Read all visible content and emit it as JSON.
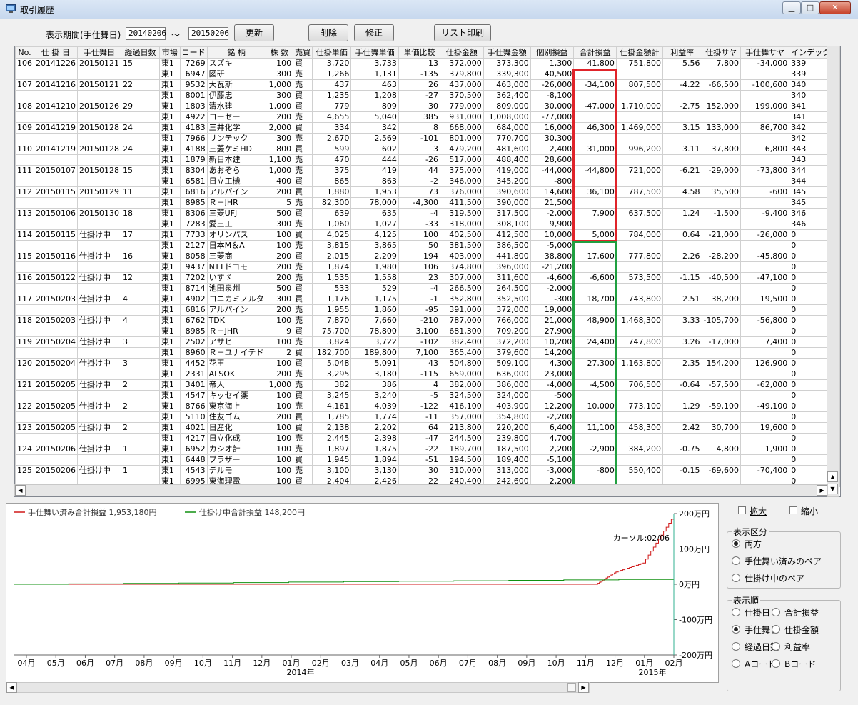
{
  "window": {
    "title": "取引履歴",
    "min": "▁",
    "max": "□",
    "close": "✕"
  },
  "toolbar": {
    "period_label": "表示期間(手仕舞日)",
    "from": "20140206",
    "tilde": "～",
    "to": "20150206",
    "refresh": "更新",
    "delete": "削除",
    "edit": "修正",
    "print": "リスト印刷"
  },
  "columns": [
    "No.",
    "仕 掛 日",
    "手仕舞日",
    "経過日数",
    "市場",
    "コード",
    "銘 柄",
    "株 数",
    "売買",
    "仕掛単価",
    "手仕舞単価",
    "単価比較",
    "仕掛金額",
    "手仕舞金額",
    "個別損益",
    "合計損益",
    "仕掛金額計",
    "利益率",
    "仕掛サヤ",
    "手仕舞サヤ",
    "インデックス"
  ],
  "rows": [
    [
      "106",
      "20141226",
      "20150121",
      "15",
      "東1",
      "7269",
      "スズキ",
      "100",
      "買",
      "3,720",
      "3,733",
      "13",
      "372,000",
      "373,300",
      "1,300",
      "41,800",
      "751,800",
      "5.56",
      "7,800",
      "-34,000",
      "339"
    ],
    [
      "",
      "",
      "",
      "",
      "東1",
      "6947",
      "図研",
      "300",
      "売",
      "1,266",
      "1,131",
      "-135",
      "379,800",
      "339,300",
      "40,500",
      "",
      "",
      "",
      "",
      "",
      "339"
    ],
    [
      "107",
      "20141216",
      "20150121",
      "22",
      "東1",
      "9532",
      "大瓦斯",
      "1,000",
      "売",
      "437",
      "463",
      "26",
      "437,000",
      "463,000",
      "-26,000",
      "-34,100",
      "807,500",
      "-4.22",
      "-66,500",
      "-100,600",
      "340"
    ],
    [
      "",
      "",
      "",
      "",
      "東1",
      "8001",
      "伊藤忠",
      "300",
      "買",
      "1,235",
      "1,208",
      "-27",
      "370,500",
      "362,400",
      "-8,100",
      "",
      "",
      "",
      "",
      "",
      "340"
    ],
    [
      "108",
      "20141210",
      "20150126",
      "29",
      "東1",
      "1803",
      "清水建",
      "1,000",
      "買",
      "779",
      "809",
      "30",
      "779,000",
      "809,000",
      "30,000",
      "-47,000",
      "1,710,000",
      "-2.75",
      "152,000",
      "199,000",
      "341"
    ],
    [
      "",
      "",
      "",
      "",
      "東1",
      "4922",
      "コーセー",
      "200",
      "売",
      "4,655",
      "5,040",
      "385",
      "931,000",
      "1,008,000",
      "-77,000",
      "",
      "",
      "",
      "",
      "",
      "341"
    ],
    [
      "109",
      "20141219",
      "20150128",
      "24",
      "東1",
      "4183",
      "三井化学",
      "2,000",
      "買",
      "334",
      "342",
      "8",
      "668,000",
      "684,000",
      "16,000",
      "46,300",
      "1,469,000",
      "3.15",
      "133,000",
      "86,700",
      "342"
    ],
    [
      "",
      "",
      "",
      "",
      "東1",
      "7966",
      "リンテック",
      "300",
      "売",
      "2,670",
      "2,569",
      "-101",
      "801,000",
      "770,700",
      "30,300",
      "",
      "",
      "",
      "",
      "",
      "342"
    ],
    [
      "110",
      "20141219",
      "20150128",
      "24",
      "東1",
      "4188",
      "三菱ケミHD",
      "800",
      "買",
      "599",
      "602",
      "3",
      "479,200",
      "481,600",
      "2,400",
      "31,000",
      "996,200",
      "3.11",
      "37,800",
      "6,800",
      "343"
    ],
    [
      "",
      "",
      "",
      "",
      "東1",
      "1879",
      "新日本建",
      "1,100",
      "売",
      "470",
      "444",
      "-26",
      "517,000",
      "488,400",
      "28,600",
      "",
      "",
      "",
      "",
      "",
      "343"
    ],
    [
      "111",
      "20150107",
      "20150128",
      "15",
      "東1",
      "8304",
      "あおぞら",
      "1,000",
      "売",
      "375",
      "419",
      "44",
      "375,000",
      "419,000",
      "-44,000",
      "-44,800",
      "721,000",
      "-6.21",
      "-29,000",
      "-73,800",
      "344"
    ],
    [
      "",
      "",
      "",
      "",
      "東1",
      "6581",
      "日立工機",
      "400",
      "買",
      "865",
      "863",
      "-2",
      "346,000",
      "345,200",
      "-800",
      "",
      "",
      "",
      "",
      "",
      "344"
    ],
    [
      "112",
      "20150115",
      "20150129",
      "11",
      "東1",
      "6816",
      "アルパイン",
      "200",
      "買",
      "1,880",
      "1,953",
      "73",
      "376,000",
      "390,600",
      "14,600",
      "36,100",
      "787,500",
      "4.58",
      "35,500",
      "-600",
      "345"
    ],
    [
      "",
      "",
      "",
      "",
      "東1",
      "8985",
      "Ｒ－JHR",
      "5",
      "売",
      "82,300",
      "78,000",
      "-4,300",
      "411,500",
      "390,000",
      "21,500",
      "",
      "",
      "",
      "",
      "",
      "345"
    ],
    [
      "113",
      "20150106",
      "20150130",
      "18",
      "東1",
      "8306",
      "三菱UFJ",
      "500",
      "買",
      "639",
      "635",
      "-4",
      "319,500",
      "317,500",
      "-2,000",
      "7,900",
      "637,500",
      "1.24",
      "-1,500",
      "-9,400",
      "346"
    ],
    [
      "",
      "",
      "",
      "",
      "東1",
      "7283",
      "愛三工",
      "300",
      "売",
      "1,060",
      "1,027",
      "-33",
      "318,000",
      "308,100",
      "9,900",
      "",
      "",
      "",
      "",
      "",
      "346"
    ],
    [
      "114",
      "20150115",
      "仕掛け中",
      "17",
      "東1",
      "7733",
      "オリンパス",
      "100",
      "買",
      "4,025",
      "4,125",
      "100",
      "402,500",
      "412,500",
      "10,000",
      "5,000",
      "784,000",
      "0.64",
      "-21,000",
      "-26,000",
      "0"
    ],
    [
      "",
      "",
      "",
      "",
      "東1",
      "2127",
      "日本M＆A",
      "100",
      "売",
      "3,815",
      "3,865",
      "50",
      "381,500",
      "386,500",
      "-5,000",
      "",
      "",
      "",
      "",
      "",
      "0"
    ],
    [
      "115",
      "20150116",
      "仕掛け中",
      "16",
      "東1",
      "8058",
      "三菱商",
      "200",
      "買",
      "2,015",
      "2,209",
      "194",
      "403,000",
      "441,800",
      "38,800",
      "17,600",
      "777,800",
      "2.26",
      "-28,200",
      "-45,800",
      "0"
    ],
    [
      "",
      "",
      "",
      "",
      "東1",
      "9437",
      "NTTドコモ",
      "200",
      "売",
      "1,874",
      "1,980",
      "106",
      "374,800",
      "396,000",
      "-21,200",
      "",
      "",
      "",
      "",
      "",
      "0"
    ],
    [
      "116",
      "20150122",
      "仕掛け中",
      "12",
      "東1",
      "7202",
      "いすゞ",
      "200",
      "売",
      "1,535",
      "1,558",
      "23",
      "307,000",
      "311,600",
      "-4,600",
      "-6,600",
      "573,500",
      "-1.15",
      "-40,500",
      "-47,100",
      "0"
    ],
    [
      "",
      "",
      "",
      "",
      "東1",
      "8714",
      "池田泉州",
      "500",
      "買",
      "533",
      "529",
      "-4",
      "266,500",
      "264,500",
      "-2,000",
      "",
      "",
      "",
      "",
      "",
      "0"
    ],
    [
      "117",
      "20150203",
      "仕掛け中",
      "4",
      "東1",
      "4902",
      "コニカミノルタ",
      "300",
      "買",
      "1,176",
      "1,175",
      "-1",
      "352,800",
      "352,500",
      "-300",
      "18,700",
      "743,800",
      "2.51",
      "38,200",
      "19,500",
      "0"
    ],
    [
      "",
      "",
      "",
      "",
      "東1",
      "6816",
      "アルパイン",
      "200",
      "売",
      "1,955",
      "1,860",
      "-95",
      "391,000",
      "372,000",
      "19,000",
      "",
      "",
      "",
      "",
      "",
      "0"
    ],
    [
      "118",
      "20150203",
      "仕掛け中",
      "4",
      "東1",
      "6762",
      "TDK",
      "100",
      "売",
      "7,870",
      "7,660",
      "-210",
      "787,000",
      "766,000",
      "21,000",
      "48,900",
      "1,468,300",
      "3.33",
      "-105,700",
      "-56,800",
      "0"
    ],
    [
      "",
      "",
      "",
      "",
      "東1",
      "8985",
      "Ｒ－JHR",
      "9",
      "買",
      "75,700",
      "78,800",
      "3,100",
      "681,300",
      "709,200",
      "27,900",
      "",
      "",
      "",
      "",
      "",
      "0"
    ],
    [
      "119",
      "20150204",
      "仕掛け中",
      "3",
      "東1",
      "2502",
      "アサヒ",
      "100",
      "売",
      "3,824",
      "3,722",
      "-102",
      "382,400",
      "372,200",
      "10,200",
      "24,400",
      "747,800",
      "3.26",
      "-17,000",
      "7,400",
      "0"
    ],
    [
      "",
      "",
      "",
      "",
      "東1",
      "8960",
      "Ｒ－ユナイテド",
      "2",
      "買",
      "182,700",
      "189,800",
      "7,100",
      "365,400",
      "379,600",
      "14,200",
      "",
      "",
      "",
      "",
      "",
      "0"
    ],
    [
      "120",
      "20150204",
      "仕掛け中",
      "3",
      "東1",
      "4452",
      "花王",
      "100",
      "買",
      "5,048",
      "5,091",
      "43",
      "504,800",
      "509,100",
      "4,300",
      "27,300",
      "1,163,800",
      "2.35",
      "154,200",
      "126,900",
      "0"
    ],
    [
      "",
      "",
      "",
      "",
      "東1",
      "2331",
      "ALSOK",
      "200",
      "売",
      "3,295",
      "3,180",
      "-115",
      "659,000",
      "636,000",
      "23,000",
      "",
      "",
      "",
      "",
      "",
      "0"
    ],
    [
      "121",
      "20150205",
      "仕掛け中",
      "2",
      "東1",
      "3401",
      "帝人",
      "1,000",
      "売",
      "382",
      "386",
      "4",
      "382,000",
      "386,000",
      "-4,000",
      "-4,500",
      "706,500",
      "-0.64",
      "-57,500",
      "-62,000",
      "0"
    ],
    [
      "",
      "",
      "",
      "",
      "東1",
      "4547",
      "キッセイ薬",
      "100",
      "買",
      "3,245",
      "3,240",
      "-5",
      "324,500",
      "324,000",
      "-500",
      "",
      "",
      "",
      "",
      "",
      "0"
    ],
    [
      "122",
      "20150205",
      "仕掛け中",
      "2",
      "東1",
      "8766",
      "東京海上",
      "100",
      "売",
      "4,161",
      "4,039",
      "-122",
      "416,100",
      "403,900",
      "12,200",
      "10,000",
      "773,100",
      "1.29",
      "-59,100",
      "-49,100",
      "0"
    ],
    [
      "",
      "",
      "",
      "",
      "東1",
      "5110",
      "住友ゴム",
      "200",
      "買",
      "1,785",
      "1,774",
      "-11",
      "357,000",
      "354,800",
      "-2,200",
      "",
      "",
      "",
      "",
      "",
      "0"
    ],
    [
      "123",
      "20150205",
      "仕掛け中",
      "2",
      "東1",
      "4021",
      "日産化",
      "100",
      "買",
      "2,138",
      "2,202",
      "64",
      "213,800",
      "220,200",
      "6,400",
      "11,100",
      "458,300",
      "2.42",
      "30,700",
      "19,600",
      "0"
    ],
    [
      "",
      "",
      "",
      "",
      "東1",
      "4217",
      "日立化成",
      "100",
      "売",
      "2,445",
      "2,398",
      "-47",
      "244,500",
      "239,800",
      "4,700",
      "",
      "",
      "",
      "",
      "",
      "0"
    ],
    [
      "124",
      "20150206",
      "仕掛け中",
      "1",
      "東1",
      "6952",
      "カシオ計",
      "100",
      "売",
      "1,897",
      "1,875",
      "-22",
      "189,700",
      "187,500",
      "2,200",
      "-2,900",
      "384,200",
      "-0.75",
      "4,800",
      "1,900",
      "0"
    ],
    [
      "",
      "",
      "",
      "",
      "東1",
      "6448",
      "ブラザー",
      "100",
      "買",
      "1,945",
      "1,894",
      "-51",
      "194,500",
      "189,400",
      "-5,100",
      "",
      "",
      "",
      "",
      "",
      "0"
    ],
    [
      "125",
      "20150206",
      "仕掛け中",
      "1",
      "東1",
      "4543",
      "テルモ",
      "100",
      "売",
      "3,100",
      "3,130",
      "30",
      "310,000",
      "313,000",
      "-3,000",
      "-800",
      "550,400",
      "-0.15",
      "-69,600",
      "-70,400",
      "0"
    ],
    [
      "",
      "",
      "",
      "",
      "東1",
      "6995",
      "東海理電",
      "100",
      "買",
      "2,404",
      "2,426",
      "22",
      "240,400",
      "242,600",
      "2,200",
      "",
      "",
      "",
      "",
      "",
      "0"
    ]
  ],
  "colors": {
    "closed_box": "#e0242a",
    "open_box": "#20a040",
    "closed_line": "#d01818",
    "open_line": "#109010",
    "cursor_line": "#30b090"
  },
  "chart_data": {
    "type": "line",
    "series": [
      {
        "name": "手仕舞い済み合計損益 1,953,180円",
        "color": "#d01818",
        "x": [
          "2014-02-06",
          "2014-12-25",
          "2015-01-05",
          "2015-01-20",
          "2015-02-06"
        ],
        "values": [
          0,
          0,
          350000,
          600000,
          1953180
        ]
      },
      {
        "name": "仕掛け中合計損益 148,200円",
        "color": "#109010",
        "x": [
          "2014-02-06",
          "2015-02-06"
        ],
        "values": [
          0,
          148200
        ]
      }
    ],
    "y_ticks": [
      "200万円",
      "100万円",
      "0万円",
      "-100万円",
      "-200万円"
    ],
    "ylim": [
      -2000000,
      2000000
    ],
    "x_ticks": [
      "04月",
      "05月",
      "06月",
      "07月",
      "08月",
      "09月",
      "10月",
      "11月",
      "12月",
      "01月",
      "02月",
      "03月",
      "04月",
      "05月",
      "06月",
      "07月",
      "08月",
      "09月",
      "10月",
      "11月",
      "12月",
      "01月",
      "02月"
    ],
    "year_labels": [
      "2014年",
      "2015年"
    ],
    "cursor_label": "カーソル:02/06",
    "cursor_date": "2015-02-06"
  },
  "options": {
    "zoom_in": "拡大",
    "zoom_out": "縮小",
    "display_group": {
      "title": "表示区分",
      "items": [
        "両方",
        "手仕舞い済みのペア",
        "仕掛け中のペア"
      ],
      "selected": 0
    },
    "order_group": {
      "title": "表示順",
      "items": [
        "仕掛日",
        "合計損益",
        "手仕舞日",
        "仕掛金額",
        "経過日数",
        "利益率",
        "Aコード",
        "Bコード"
      ],
      "selected": 2
    }
  }
}
